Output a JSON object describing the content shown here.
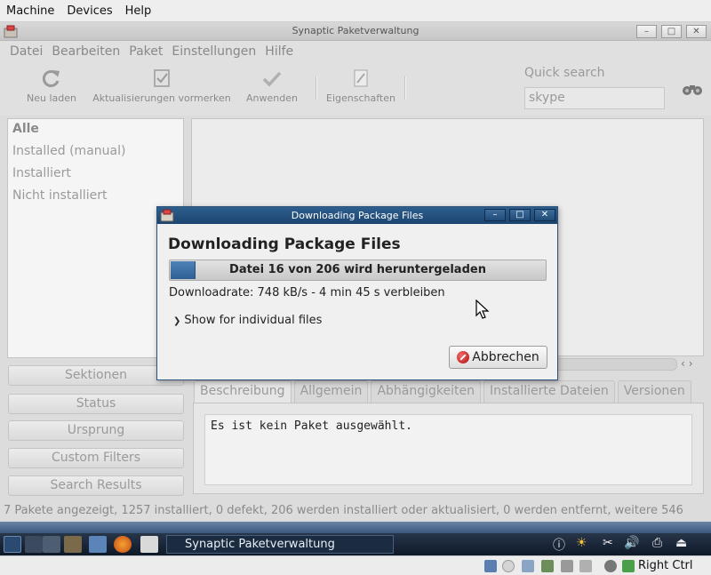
{
  "host_menu": {
    "items": [
      {
        "label": "Machine"
      },
      {
        "label": "Devices"
      },
      {
        "label": "Help"
      }
    ]
  },
  "main_window": {
    "title": "Synaptic Paketverwaltung"
  },
  "app_menu": {
    "items": [
      {
        "label": "Datei"
      },
      {
        "label": "Bearbeiten"
      },
      {
        "label": "Paket"
      },
      {
        "label": "Einstellungen"
      },
      {
        "label": "Hilfe"
      }
    ]
  },
  "toolbar": {
    "reload_label": "Neu laden",
    "mark_upgrades_label": "Aktualisierungen vormerken",
    "apply_label": "Anwenden",
    "properties_label": "Eigenschaften",
    "quick_search_label": "Quick search",
    "quick_search_value": "skype"
  },
  "filters": {
    "items": [
      {
        "label": "Alle"
      },
      {
        "label": "Installed (manual)"
      },
      {
        "label": "Installiert"
      },
      {
        "label": "Nicht installiert"
      }
    ]
  },
  "side_buttons": {
    "sections": "Sektionen",
    "status": "Status",
    "origin": "Ursprung",
    "custom_filters": "Custom Filters",
    "search_results": "Search Results"
  },
  "details": {
    "tabs": [
      {
        "label": "Beschreibung"
      },
      {
        "label": "Allgemein"
      },
      {
        "label": "Abhängigkeiten"
      },
      {
        "label": "Installierte Dateien"
      },
      {
        "label": "Versionen"
      }
    ],
    "description_text": "Es ist kein Paket ausgewählt."
  },
  "statusbar": {
    "text": "7 Pakete angezeigt, 1257 installiert, 0 defekt, 206 werden installiert oder aktualisiert, 0 werden entfernt, weitere 546"
  },
  "dialog": {
    "title": "Downloading Package Files",
    "heading": "Downloading Package Files",
    "progress_text": "Datei 16 von 206 wird heruntergeladen",
    "progress_fraction": 0.066,
    "rate_text": "Downloadrate: 748 kB/s - 4 min 45 s verbleiben",
    "expander_label": "Show for individual files",
    "cancel_label": "Abbrechen"
  },
  "taskbar": {
    "task_label": "Synaptic Paketverwaltung"
  },
  "vbox_status": {
    "host_key": "Right Ctrl"
  },
  "colors": {
    "dialog_title_bg": "#1c4470",
    "progress_fill": "#2d5f93",
    "taskbar_bg": "#0e1828"
  }
}
